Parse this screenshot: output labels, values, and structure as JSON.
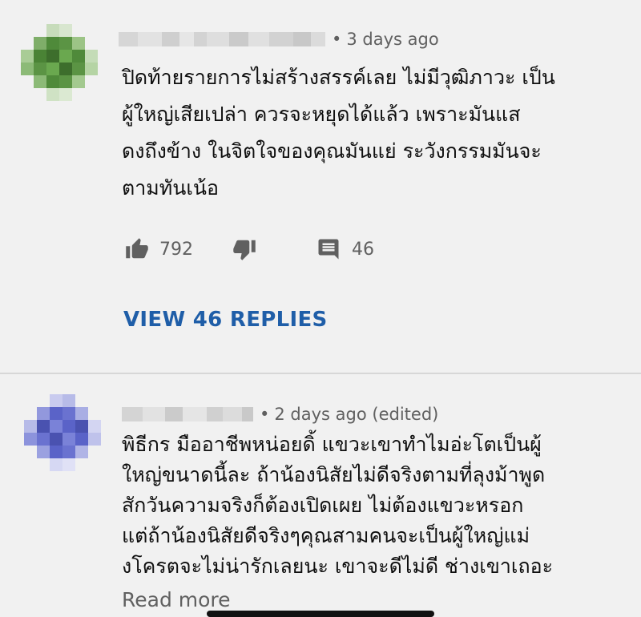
{
  "comments": [
    {
      "timestamp": "3 days ago",
      "text_lines": [
        "ปิดท้ายรายการไม่สร้างสรรค์เลย ไม่มีวุฒิภาวะ เป็น",
        "ผู้ใหญ่เสียเปล่า ควรจะหยุดได้แล้ว เพราะมันแส",
        "ดงถึงข้าง ในจิตใจของคุณมันแย่ ระวังกรรมมันจะ",
        "ตามทันเน้อ"
      ],
      "like_count": "792",
      "reply_count": "46",
      "view_replies_label": "VIEW 46 REPLIES",
      "avatar_colors": [
        "#4f8a3a",
        "#6aa84f",
        "#3d6e2c",
        "#a3c98f"
      ]
    },
    {
      "timestamp": "2 days ago (edited)",
      "text_lines": [
        "พิธีกร มืออาชีพหน่อยดิ้ แขวะเขาทำไมอ่ะโตเป็นผู้",
        "ใหญ่ขนาดนี้ละ ถ้าน้องนิสัยไม่ดีจริงตามที่ลุงม้าพูด",
        "สักวันความจริงก็ต้องเปิดเผย ไม่ต้องแขวะหรอก",
        "แต่ถ้าน้องนิสัยดีจริงๆคุณสามคนจะเป็นผู้ใหญ่แม่",
        "งโครตจะไม่น่ารักเลยนะ เขาจะดีไม่ดี ช่างเขาเถอะ"
      ],
      "read_more_label": "Read more",
      "avatar_colors": [
        "#5a63c8",
        "#7a82d8",
        "#4a52b0",
        "#b7bbe8"
      ]
    }
  ],
  "meta_separator": "•",
  "icons": {
    "like": "thumb-up-icon",
    "dislike": "thumb-down-icon",
    "reply": "comment-icon"
  },
  "colors": {
    "background": "#f1f1f1",
    "link": "#1f5ea8",
    "secondary_text": "#606060"
  }
}
